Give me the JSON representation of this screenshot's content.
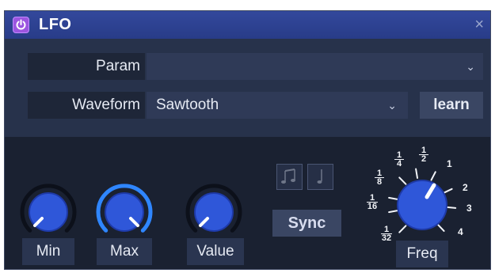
{
  "window": {
    "title": "LFO",
    "close_glyph": "×",
    "power_icon": "power-icon"
  },
  "param": {
    "label": "Param",
    "value": ""
  },
  "waveform": {
    "label": "Waveform",
    "value": "Sawtooth",
    "learn_label": "learn"
  },
  "knobs": {
    "min": {
      "label": "Min"
    },
    "max": {
      "label": "Max"
    },
    "value": {
      "label": "Value"
    },
    "freq": {
      "label": "Freq"
    }
  },
  "sync": {
    "label": "Sync",
    "icons": [
      "beamed-notes-icon",
      "quarter-note-icon"
    ]
  },
  "freq_scale": {
    "ticks": [
      {
        "num": "1",
        "den": "32"
      },
      {
        "num": "1",
        "den": "16"
      },
      {
        "num": "1",
        "den": "8"
      },
      {
        "num": "1",
        "den": "4"
      },
      {
        "num": "1",
        "den": "2"
      },
      {
        "label": "1"
      },
      {
        "label": "2"
      },
      {
        "label": "3"
      },
      {
        "label": "4"
      }
    ]
  },
  "colors": {
    "accent": "#2f57d9",
    "max_arc": "#2f86ff",
    "title_bar": "#2c3f8e",
    "power": "#9b55e0"
  }
}
